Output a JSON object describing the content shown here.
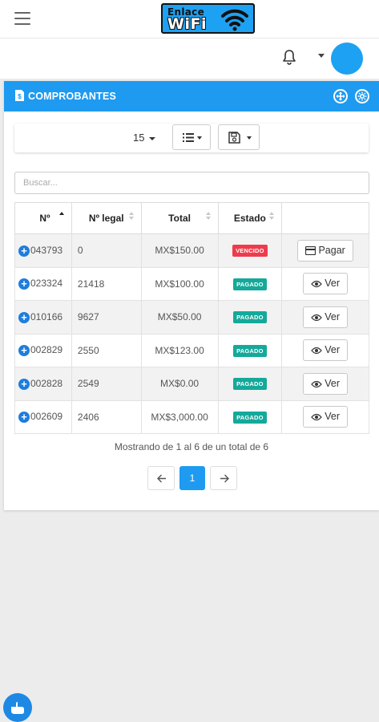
{
  "header": {
    "logo_line1": "Enlace",
    "logo_line2": "WiFi",
    "brand_color": "#1da1f2"
  },
  "panel": {
    "title": "COMPROBANTES",
    "accent": "#1e9bf0",
    "page_size": "15",
    "search_placeholder": "Buscar..."
  },
  "table": {
    "columns": [
      "Nº",
      "Nº legal",
      "Total",
      "Estado",
      ""
    ],
    "rows": [
      {
        "num": "043793",
        "legal": "0",
        "total": "MX$150.00",
        "estado": "VENCIDO",
        "action": "Pagar"
      },
      {
        "num": "023324",
        "legal": "21418",
        "total": "MX$100.00",
        "estado": "PAGADO",
        "action": "Ver"
      },
      {
        "num": "010166",
        "legal": "9627",
        "total": "MX$50.00",
        "estado": "PAGADO",
        "action": "Ver"
      },
      {
        "num": "002829",
        "legal": "2550",
        "total": "MX$123.00",
        "estado": "PAGADO",
        "action": "Ver"
      },
      {
        "num": "002828",
        "legal": "2549",
        "total": "MX$0.00",
        "estado": "PAGADO",
        "action": "Ver"
      },
      {
        "num": "002609",
        "legal": "2406",
        "total": "MX$3,000.00",
        "estado": "PAGADO",
        "action": "Ver"
      }
    ],
    "status_colors": {
      "VENCIDO": "#ee3c4c",
      "PAGADO": "#14a99a"
    }
  },
  "footer": {
    "info": "Mostrando de 1 al 6 de un total de 6",
    "current_page": "1"
  },
  "icons": [
    "menu-icon",
    "bell-icon",
    "document-icon",
    "expand-icon",
    "settings-icon",
    "list-icon",
    "save-icon",
    "credit-card-icon",
    "eye-icon",
    "arrow-left-icon",
    "arrow-right-icon",
    "hand-icon"
  ]
}
